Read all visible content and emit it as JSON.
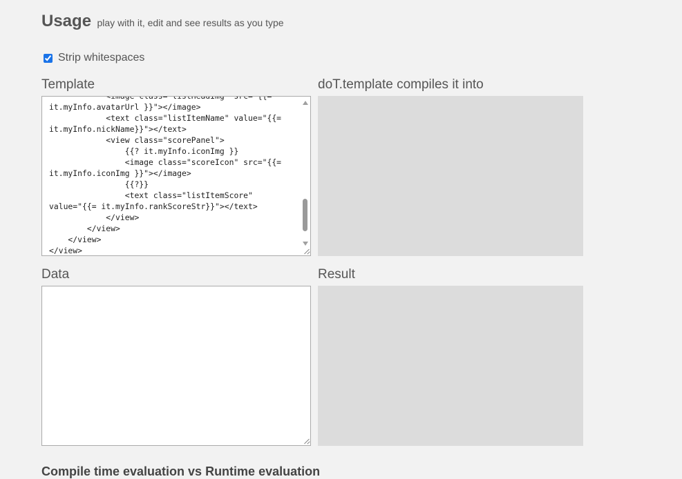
{
  "header": {
    "title": "Usage",
    "subtitle": "play with it, edit and see results as you type"
  },
  "options": {
    "strip_whitespaces_label": "Strip whitespaces",
    "strip_whitespaces_checked": true
  },
  "panels": {
    "template_label": "Template",
    "compiled_label": "doT.template compiles it into",
    "data_label": "Data",
    "result_label": "Result"
  },
  "template_code": "            <image class=\"listHeadImg\" src=\"{{=\nit.myInfo.avatarUrl }}\"></image>\n            <text class=\"listItemName\" value=\"{{=\nit.myInfo.nickName}}\"></text>\n            <view class=\"scorePanel\">\n                {{? it.myInfo.iconImg }}\n                <image class=\"scoreIcon\" src=\"{{=\nit.myInfo.iconImg }}\"></image>\n                {{?}}\n                <text class=\"listItemScore\"\nvalue=\"{{= it.myInfo.rankScoreStr}}\"></text>\n            </view>\n        </view>\n    </view>\n</view>",
  "data_value": "",
  "section_heading": "Compile time evaluation vs Runtime evaluation",
  "colors": {
    "background": "#f2f2f2",
    "output_panel": "#dcdcdc",
    "checkbox_accent": "#1a73e8"
  }
}
